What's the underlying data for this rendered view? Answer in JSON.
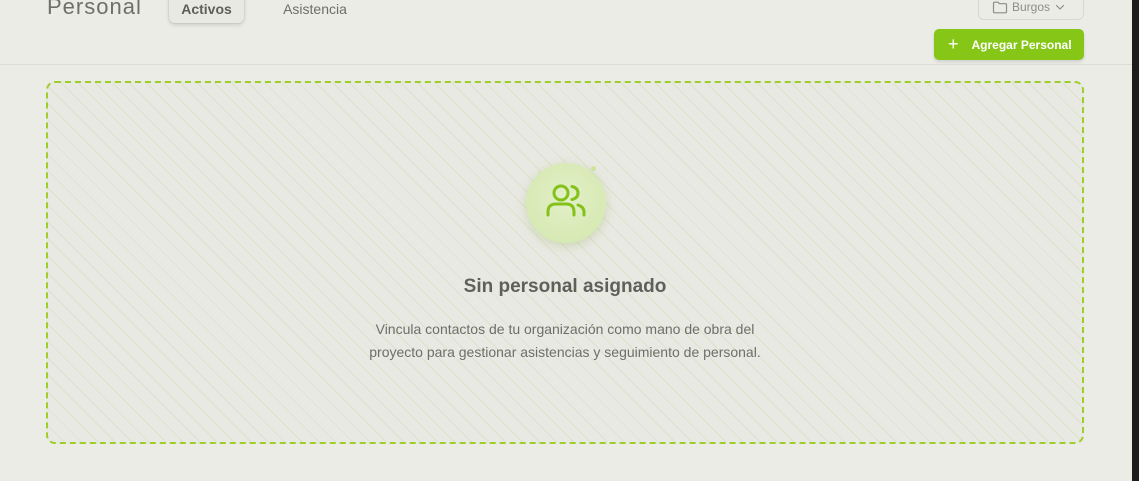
{
  "header": {
    "title": "Personal",
    "tabs": [
      {
        "label": "Activos",
        "active": true
      },
      {
        "label": "Asistencia",
        "active": false
      }
    ],
    "location_select": {
      "value": "Burgos",
      "icon": "folder-icon"
    },
    "add_button": {
      "label": "Agregar Personal",
      "icon": "plus-icon"
    }
  },
  "empty_state": {
    "icon": "users-icon",
    "title": "Sin personal asignado",
    "description_lines": [
      "Vincula contactos de tu organización como mano de obra del",
      "proyecto para gestionar asistencias y seguimiento de personal."
    ]
  },
  "colors": {
    "accent": "#86c616",
    "background": "#ecece7",
    "dashed_border": "#9fce2a"
  }
}
